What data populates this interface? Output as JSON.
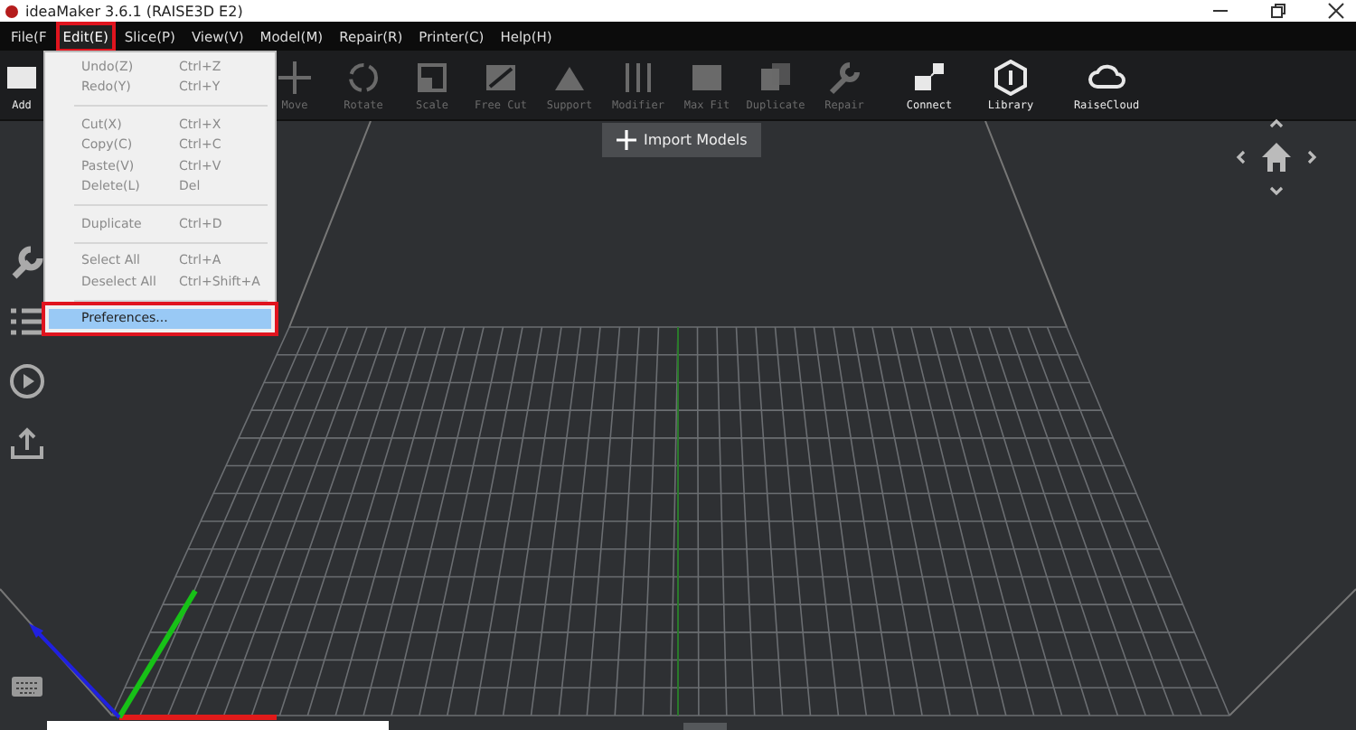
{
  "window": {
    "title": "ideaMaker 3.6.1 (RAISE3D E2)"
  },
  "menubar": [
    {
      "label": "File(F",
      "selected": false
    },
    {
      "label": "Edit(E)",
      "selected": true
    },
    {
      "label": "Slice(P)",
      "selected": false
    },
    {
      "label": "View(V)",
      "selected": false
    },
    {
      "label": "Model(M)",
      "selected": false
    },
    {
      "label": "Repair(R)",
      "selected": false
    },
    {
      "label": "Printer(C)",
      "selected": false
    },
    {
      "label": "Help(H)",
      "selected": false
    }
  ],
  "toolbar": [
    {
      "label": "Add",
      "disabled": false
    },
    {
      "label": "Move",
      "disabled": true
    },
    {
      "label": "Rotate",
      "disabled": true
    },
    {
      "label": "Scale",
      "disabled": true
    },
    {
      "label": "Free Cut",
      "disabled": true
    },
    {
      "label": "Support",
      "disabled": true
    },
    {
      "label": "Modifier",
      "disabled": true
    },
    {
      "label": "Max Fit",
      "disabled": true
    },
    {
      "label": "Duplicate",
      "disabled": true
    },
    {
      "label": "Repair",
      "disabled": true
    },
    {
      "label": "Connect",
      "disabled": false
    },
    {
      "label": "Library",
      "disabled": false
    },
    {
      "label": "RaiseCloud",
      "disabled": false
    }
  ],
  "edit_menu": [
    {
      "kind": "item",
      "label": "Undo(Z)",
      "shortcut": "Ctrl+Z",
      "disabled": true,
      "selected": false
    },
    {
      "kind": "item",
      "label": "Redo(Y)",
      "shortcut": "Ctrl+Y",
      "disabled": true,
      "selected": false
    },
    {
      "kind": "separator"
    },
    {
      "kind": "item",
      "label": "Cut(X)",
      "shortcut": "Ctrl+X",
      "disabled": true,
      "selected": false
    },
    {
      "kind": "item",
      "label": "Copy(C)",
      "shortcut": "Ctrl+C",
      "disabled": true,
      "selected": false
    },
    {
      "kind": "item",
      "label": "Paste(V)",
      "shortcut": "Ctrl+V",
      "disabled": true,
      "selected": false
    },
    {
      "kind": "item",
      "label": "Delete(L)",
      "shortcut": "Del",
      "disabled": true,
      "selected": false
    },
    {
      "kind": "separator"
    },
    {
      "kind": "item",
      "label": "Duplicate",
      "shortcut": "Ctrl+D",
      "disabled": true,
      "selected": false
    },
    {
      "kind": "separator"
    },
    {
      "kind": "item",
      "label": "Select All",
      "shortcut": "Ctrl+A",
      "disabled": true,
      "selected": false
    },
    {
      "kind": "item",
      "label": "Deselect All",
      "shortcut": "Ctrl+Shift+A",
      "disabled": true,
      "selected": false
    },
    {
      "kind": "separator"
    },
    {
      "kind": "item",
      "label": "Preferences...",
      "disabled": false,
      "selected": true
    }
  ],
  "viewport": {
    "import_button": "Import Models"
  }
}
